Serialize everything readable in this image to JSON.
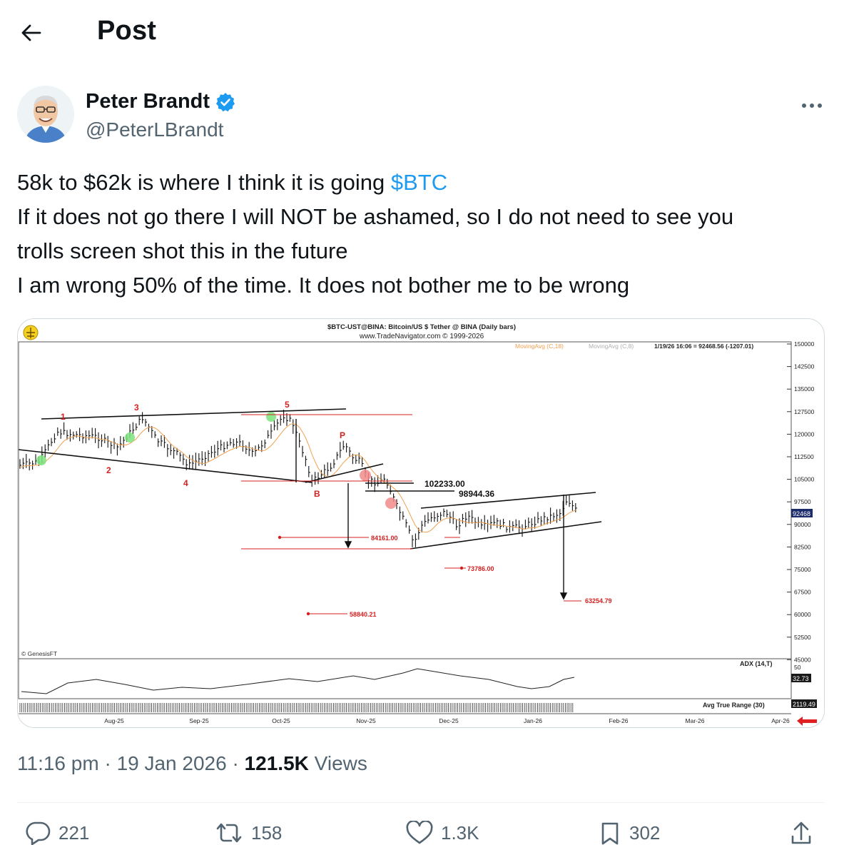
{
  "header": {
    "title": "Post",
    "back_icon": "arrow-left-icon"
  },
  "author": {
    "display_name": "Peter Brandt",
    "handle": "@PeterLBrandt",
    "verified": true,
    "verified_color": "#1d9bf0"
  },
  "tweet": {
    "line1_text": "58k to $62k is where I think it is going ",
    "cashtag": "$BTC",
    "line2": "If it does not go there I will NOT be ashamed, so I do not need to see you",
    "line3": "trolls screen shot this in the future",
    "line4": "I am wrong 50% of the time. It does not bother me to be wrong"
  },
  "meta": {
    "time": "11:16 pm",
    "date": "19 Jan 2026",
    "views_count": "121.5K",
    "views_label": "Views"
  },
  "actions": {
    "replies": "221",
    "reposts": "158",
    "likes": "1.3K",
    "bookmarks": "302"
  },
  "chart_image": {
    "header_line1": "$BTC-UST@BINA:  Bitcoin/US $ Tether @ BINA  (Daily bars)",
    "header_line2": "www.TradeNavigator.com © 1999-2026",
    "ma1_label": "MovingAvg (C,18)",
    "ma2_label": "MovingAvg (C,8)",
    "readout": "1/19/26 16:06 = 92468.56 (-1207.01)",
    "watermark": "© GenesisFT",
    "adx_label": "ADX (14,T)",
    "atr_label": "Avg True Range (30)",
    "adx_value": "32.73",
    "atr_value": "2119.49",
    "last_price_tag": "92468",
    "price_axis": [
      "150000",
      "142500",
      "135000",
      "127500",
      "120000",
      "112500",
      "105000",
      "97500",
      "90000",
      "82500",
      "75000",
      "67500",
      "60000",
      "52500",
      "45000"
    ],
    "adx_axis": [
      "50"
    ],
    "date_axis": [
      "Aug-25",
      "Sep-25",
      "Oct-25",
      "Nov-25",
      "Dec-25",
      "Jan-26",
      "Feb-26",
      "Mar-26",
      "Apr-26"
    ],
    "wave_labels": [
      "1",
      "2",
      "3",
      "4",
      "5",
      "P",
      "B"
    ],
    "levels": [
      "102233.00",
      "98944.36",
      "84161.00",
      "73786.00",
      "63254.79",
      "58840.21"
    ],
    "colors": {
      "annotation_red": "#d42020",
      "ma_orange": "#f0a050",
      "signal_green": "#7be37b",
      "signal_red": "#f28a8a"
    }
  }
}
